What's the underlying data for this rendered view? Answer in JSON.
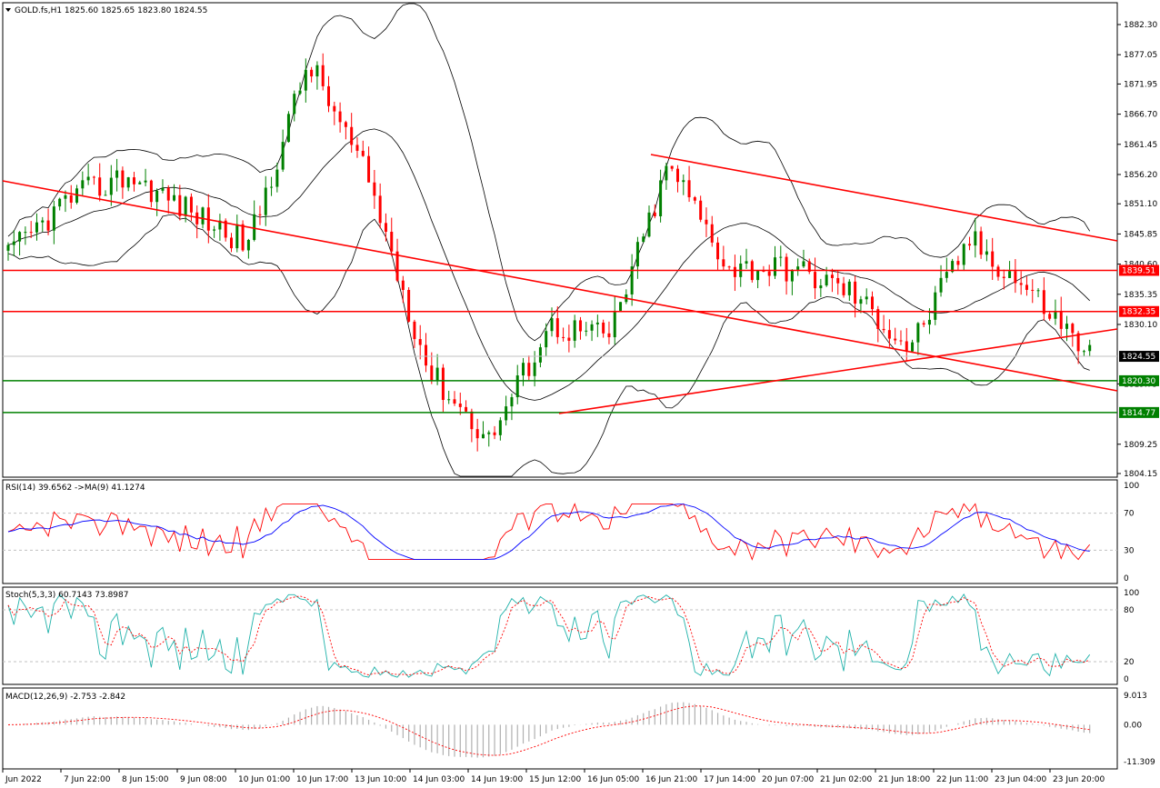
{
  "header": {
    "symbol_line": "GOLD.fs,H1  1825.60 1825.65 1823.80 1824.55"
  },
  "price_panel": {
    "ticks": [
      "1882.30",
      "1877.05",
      "1871.95",
      "1866.70",
      "1861.45",
      "1856.20",
      "1851.10",
      "1845.85",
      "1840.60",
      "1835.35",
      "1830.10",
      "1819.75",
      "1809.25",
      "1804.15"
    ],
    "tick_values": [
      1882.3,
      1877.05,
      1871.95,
      1866.7,
      1861.45,
      1856.2,
      1851.1,
      1845.85,
      1840.6,
      1835.35,
      1830.1,
      1819.75,
      1809.25,
      1804.15
    ],
    "current_price": {
      "label": "1824.55",
      "value": 1824.55
    },
    "levels": [
      {
        "label": "1839.51",
        "value": 1839.51,
        "color": "#ff0000"
      },
      {
        "label": "1832.35",
        "value": 1832.35,
        "color": "#ff0000"
      },
      {
        "label": "1820.30",
        "value": 1820.3,
        "color": "#008000"
      },
      {
        "label": "1814.77",
        "value": 1814.77,
        "color": "#008000"
      }
    ]
  },
  "rsi_panel": {
    "label": "RSI(14) 39.6562  ->MA(9) 41.1274",
    "ticks": [
      "100",
      "70",
      "30",
      "0"
    ],
    "tick_values": [
      100,
      70,
      30,
      0
    ]
  },
  "stoch_panel": {
    "label": "Stoch(5,3,3) 60.7143 73.8987",
    "ticks": [
      "100",
      "80",
      "20",
      "0"
    ],
    "tick_values": [
      100,
      80,
      20,
      0
    ]
  },
  "macd_panel": {
    "label": "MACD(12,26,9) -2.753 -2.842",
    "ticks": [
      "9.013",
      "0.00",
      "-11.309"
    ],
    "tick_values": [
      9.013,
      0,
      -11.309
    ]
  },
  "x_axis": {
    "labels": [
      "Jun 2022",
      "7 Jun 22:00",
      "8 Jun 15:00",
      "9 Jun 08:00",
      "10 Jun 01:00",
      "10 Jun 17:00",
      "13 Jun 10:00",
      "14 Jun 03:00",
      "14 Jun 19:00",
      "15 Jun 12:00",
      "16 Jun 05:00",
      "16 Jun 21:00",
      "17 Jun 14:00",
      "20 Jun 07:00",
      "21 Jun 02:00",
      "21 Jun 18:00",
      "22 Jun 11:00",
      "23 Jun 04:00",
      "23 Jun 20:00"
    ]
  },
  "chart_data": {
    "type": "line",
    "title": "GOLD.fs,H1",
    "series": [
      {
        "name": "GOLD.fs close (approx)",
        "x_anchor": [
          "Jun 2022",
          "7 Jun 22:00",
          "8 Jun 15:00",
          "9 Jun 08:00",
          "10 Jun 01:00",
          "10 Jun 17:00",
          "13 Jun 10:00",
          "14 Jun 03:00",
          "14 Jun 19:00",
          "15 Jun 12:00",
          "16 Jun 05:00",
          "16 Jun 21:00",
          "17 Jun 14:00",
          "20 Jun 07:00",
          "21 Jun 02:00",
          "21 Jun 18:00",
          "22 Jun 11:00",
          "23 Jun 04:00",
          "23 Jun 20:00"
        ],
        "values": [
          1842,
          1852,
          1856,
          1850,
          1844,
          1876,
          1855,
          1822,
          1810,
          1830,
          1828,
          1858,
          1840,
          1840,
          1836,
          1826,
          1845,
          1836,
          1825
        ]
      }
    ],
    "ylim": [
      1804.15,
      1882.3
    ],
    "colors": {
      "bull": "#008000",
      "bear": "#ff0000",
      "trendline": "#ff0000",
      "band": "#000000",
      "rsi": "#ff0000",
      "rsi_ma": "#0000ff",
      "stoch_main": "#20b2aa",
      "stoch_signal": "#ff0000",
      "macd_hist": "#b0b0b0",
      "macd_signal": "#ff0000"
    }
  }
}
